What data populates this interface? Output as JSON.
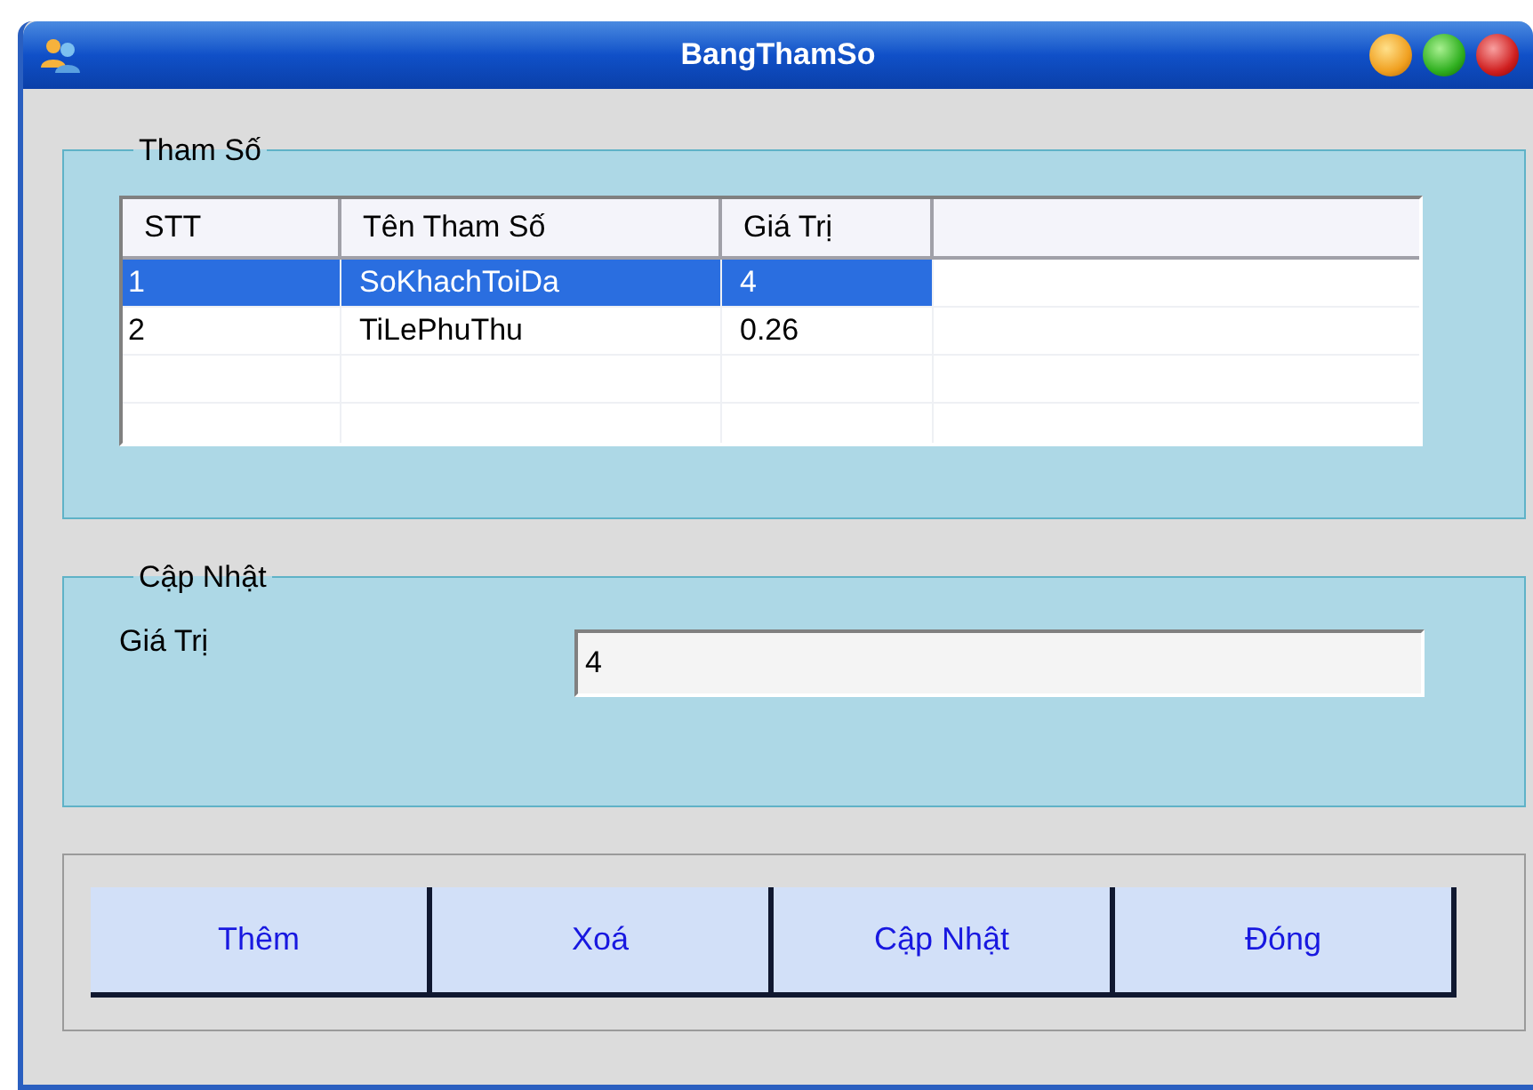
{
  "window": {
    "title": "BangThamSo"
  },
  "params_group": {
    "title": "Tham Số",
    "table": {
      "columns": [
        "STT",
        "Tên Tham Số",
        "Giá Trị"
      ],
      "rows": [
        {
          "cells": [
            "1",
            "SoKhachToiDa",
            "4"
          ],
          "selected": true
        },
        {
          "cells": [
            "2",
            "TiLePhuThu",
            "0.26"
          ],
          "selected": false
        }
      ]
    }
  },
  "update_group": {
    "title": "Cập Nhật",
    "label": "Giá Trị",
    "value": "4"
  },
  "buttons": [
    "Thêm",
    "Xoá",
    "Cập Nhật",
    "Đóng"
  ]
}
